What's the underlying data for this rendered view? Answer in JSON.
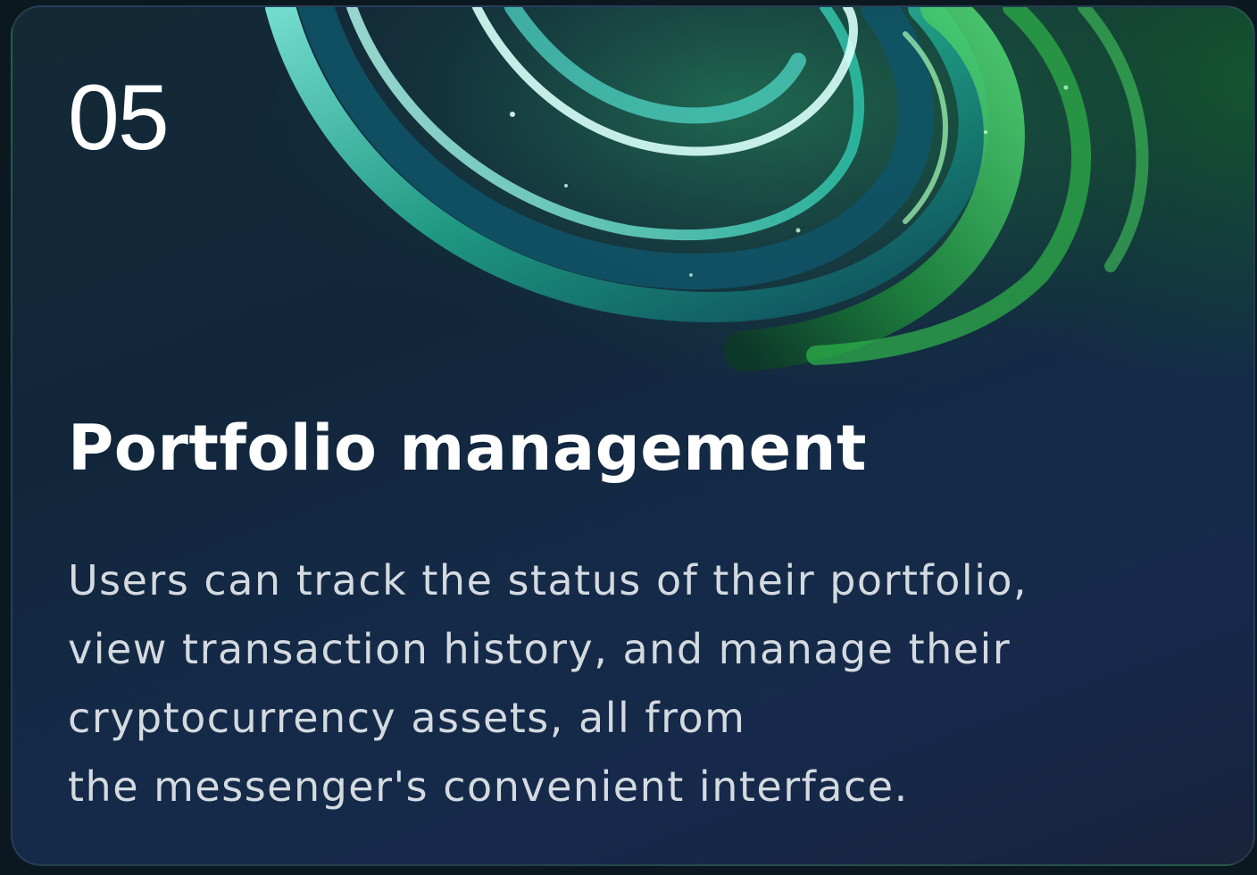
{
  "card": {
    "number": "05",
    "title": "Portfolio management",
    "description_lines": [
      "Users can track the status of their portfolio,",
      "view transaction history, and manage their",
      "cryptocurrency assets, all from",
      "the messenger's convenient interface."
    ]
  },
  "colors": {
    "card_background": "#132a36",
    "accent_green": "#2fd27a",
    "accent_teal": "#3ce0c8",
    "text_primary": "#ffffff",
    "text_secondary": "#d4dae0"
  },
  "decoration": {
    "icon": "abstract-glass-swirl"
  }
}
